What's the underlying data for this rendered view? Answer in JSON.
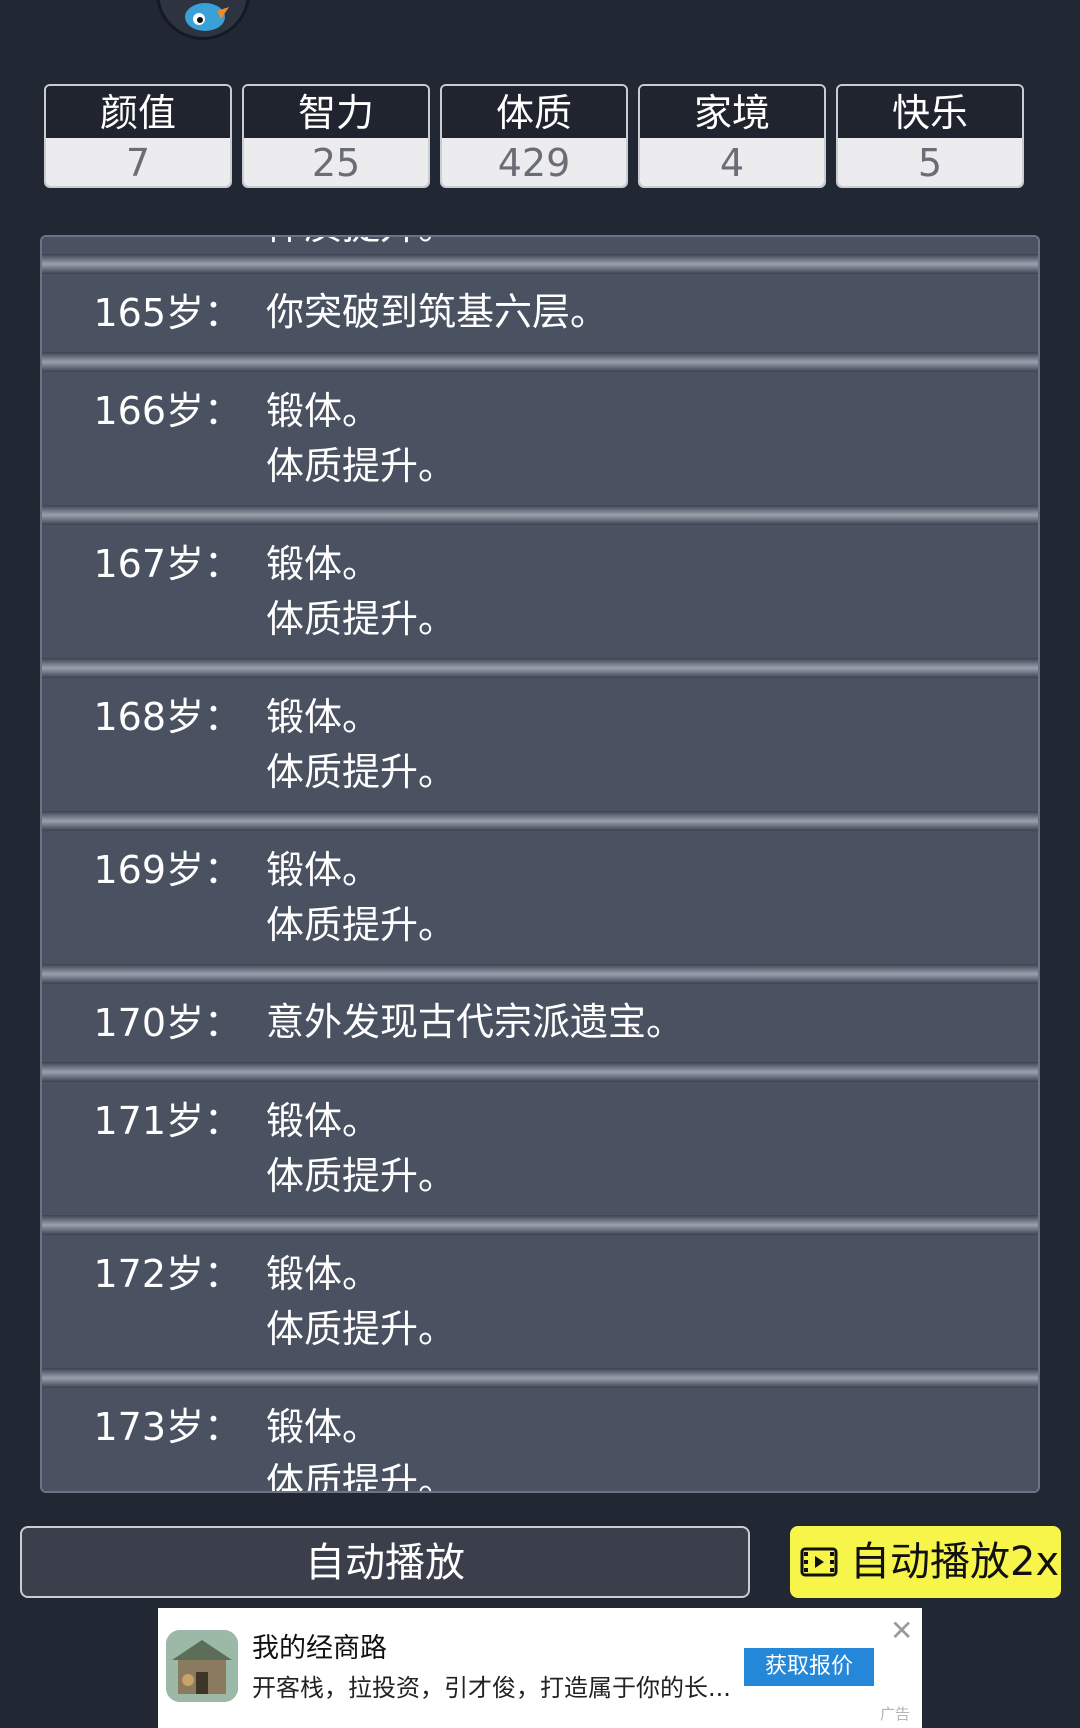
{
  "stats": [
    {
      "label": "颜值",
      "value": "7"
    },
    {
      "label": "智力",
      "value": "25"
    },
    {
      "label": "体质",
      "value": "429"
    },
    {
      "label": "家境",
      "value": "4"
    },
    {
      "label": "快乐",
      "value": "5"
    }
  ],
  "log": {
    "partial_top": "体质提升。",
    "entries": [
      {
        "age": "165岁：",
        "lines": [
          "你突破到筑基六层。"
        ]
      },
      {
        "age": "166岁：",
        "lines": [
          "锻体。",
          "体质提升。"
        ]
      },
      {
        "age": "167岁：",
        "lines": [
          "锻体。",
          "体质提升。"
        ]
      },
      {
        "age": "168岁：",
        "lines": [
          "锻体。",
          "体质提升。"
        ]
      },
      {
        "age": "169岁：",
        "lines": [
          "锻体。",
          "体质提升。"
        ]
      },
      {
        "age": "170岁：",
        "lines": [
          "意外发现古代宗派遗宝。"
        ]
      },
      {
        "age": "171岁：",
        "lines": [
          "锻体。",
          "体质提升。"
        ]
      },
      {
        "age": "172岁：",
        "lines": [
          "锻体。",
          "体质提升。"
        ]
      },
      {
        "age": "173岁：",
        "lines": [
          "锻体。",
          "体质提升。"
        ]
      }
    ]
  },
  "buttons": {
    "auto_play": "自动播放",
    "auto_play_2x": "自动播放2x"
  },
  "ad": {
    "title": "我的经商路",
    "description": "开客栈，拉投资，引才俊，打造属于你的长...",
    "cta": "获取报价",
    "close": "✕",
    "tag": "广告"
  },
  "colors": {
    "background": "#222734",
    "panel": "#4a5262",
    "accent_button": "#f7f54a",
    "ad_cta": "#2587d8"
  },
  "icons": [
    "avatar-mascot-icon",
    "film-icon",
    "close-icon"
  ]
}
